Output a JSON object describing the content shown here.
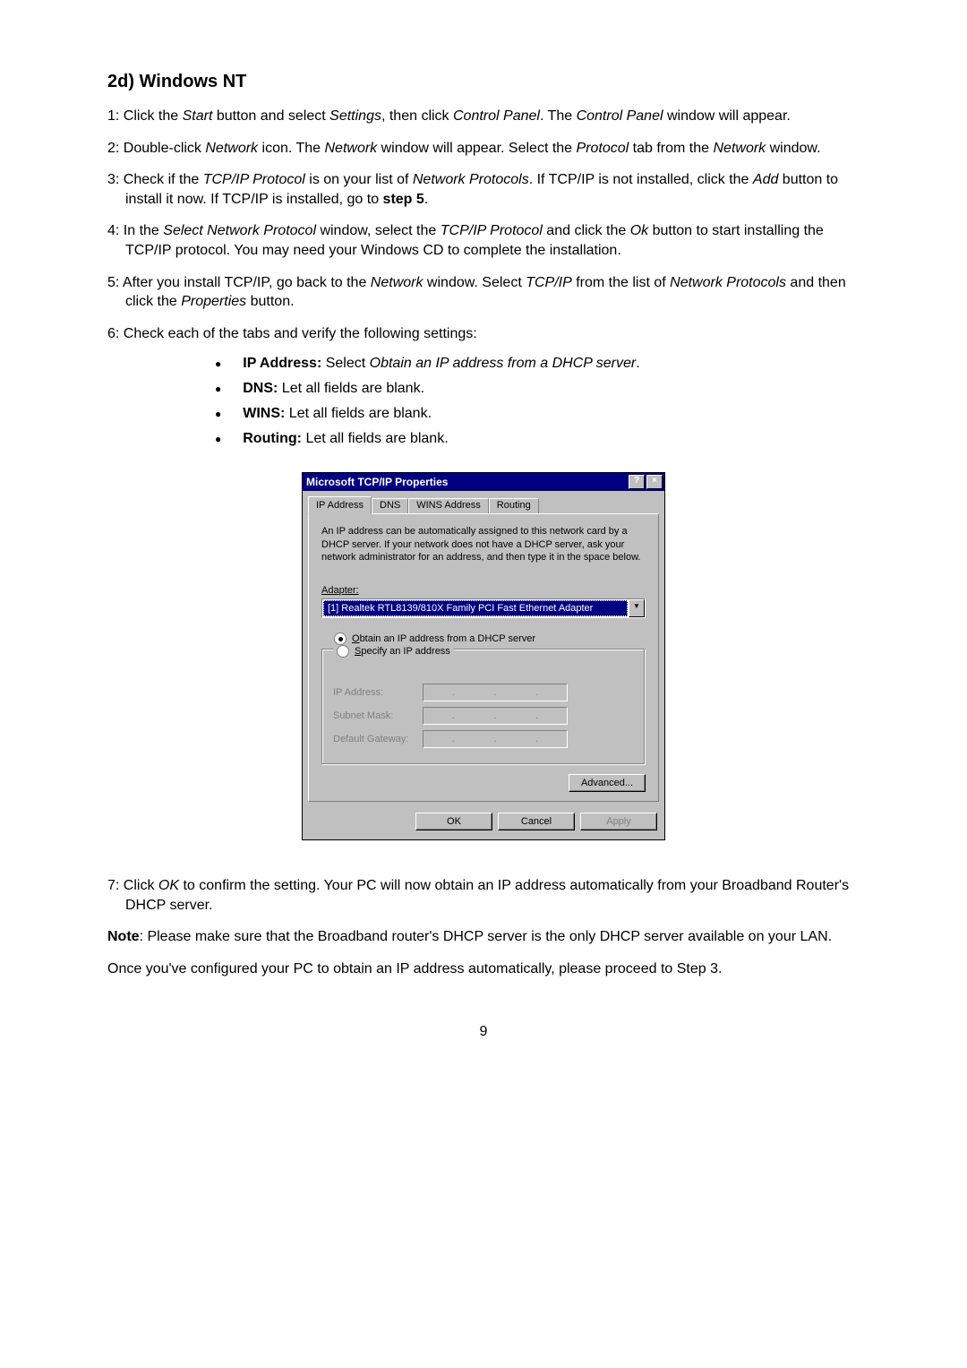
{
  "heading": "2d) Windows NT",
  "steps": {
    "s1_a": "1: Click the ",
    "s1_b": "Start",
    "s1_c": " button and select ",
    "s1_d": "Settings",
    "s1_e": ", then click ",
    "s1_f": "Control Panel",
    "s1_g": ". The ",
    "s1_h": "Control Panel",
    "s1_i": " window will appear.",
    "s2_a": "2: Double-click ",
    "s2_b": "Network",
    "s2_c": " icon. The ",
    "s2_d": "Network",
    "s2_e": " window will appear. Select the ",
    "s2_f": "Protocol",
    "s2_g": " tab from the ",
    "s2_h": "Network",
    "s2_i": " window.",
    "s3_a": "3: Check if the ",
    "s3_b": "TCP/IP Protocol",
    "s3_c": " is on your list of ",
    "s3_d": "Network Protocols",
    "s3_e": ". If TCP/IP is not installed, click the ",
    "s3_f": "Add",
    "s3_g": " button to install it now. If TCP/IP is installed, go to ",
    "s3_h": "step 5",
    "s3_i": ".",
    "s4_a": "4: In the ",
    "s4_b": "Select Network Protocol",
    "s4_c": " window, select the ",
    "s4_d": "TCP/IP Protocol",
    "s4_e": " and click the ",
    "s4_f": "Ok",
    "s4_g": " button to start installing the TCP/IP protocol. You may need your Windows CD to complete the installation.",
    "s5_a": "5: After you install TCP/IP, go back to the ",
    "s5_b": "Network",
    "s5_c": " window. Select ",
    "s5_d": "TCP/IP",
    "s5_e": " from the list of ",
    "s5_f": "Network Protocols",
    "s5_g": " and then click the ",
    "s5_h": "Properties",
    "s5_i": " button.",
    "s6": "6: Check each of the tabs and verify the following settings:"
  },
  "bullets": {
    "b1_a": "IP Address:",
    "b1_b": " Select ",
    "b1_c": "Obtain an IP address from a DHCP server",
    "b1_d": ".",
    "b2_a": "DNS:",
    "b2_b": " Let all fields are blank.",
    "b3_a": "WINS:",
    "b3_b": " Let all fields are blank.",
    "b4_a": "Routing:",
    "b4_b": " Let all fields are blank."
  },
  "dialog": {
    "title": "Microsoft TCP/IP Properties",
    "help": "?",
    "close": "×",
    "tabs": {
      "ip": "IP Address",
      "dns": "DNS",
      "wins": "WINS Address",
      "routing": "Routing"
    },
    "desc": "An IP address can be automatically assigned to this network card by a DHCP server. If your network does not have a DHCP server, ask your network administrator for an address, and then type it in the space below.",
    "adapter_label_pre": "Ada",
    "adapter_label_u": "p",
    "adapter_label_post": "ter:",
    "adapter_value": "[1] Realtek RTL8139/810X Family PCI Fast Ethernet Adapter",
    "radio1_pre": "",
    "radio1_u": "O",
    "radio1_post": "btain an IP address from a DHCP server",
    "radio2_u": "S",
    "radio2_post": "pecify an IP address",
    "ip_label": "IP Address:",
    "subnet_label": "Subnet Mask:",
    "gateway_label": "Default Gateway:",
    "dot": ".",
    "advanced": "Advanced...",
    "ok": "OK",
    "cancel": "Cancel",
    "apply": "Apply"
  },
  "after": {
    "p7_a": "7: Click ",
    "p7_b": "OK",
    "p7_c": " to confirm the setting. Your PC will now obtain an IP address automatically from your Broadband Router's DHCP server.",
    "note_a": "Note",
    "note_b": ": Please make sure that the Broadband router's DHCP server is the only DHCP server available on your LAN.",
    "once": "Once you've configured your PC to obtain an IP address automatically, please proceed to Step 3."
  },
  "pagenum": "9"
}
